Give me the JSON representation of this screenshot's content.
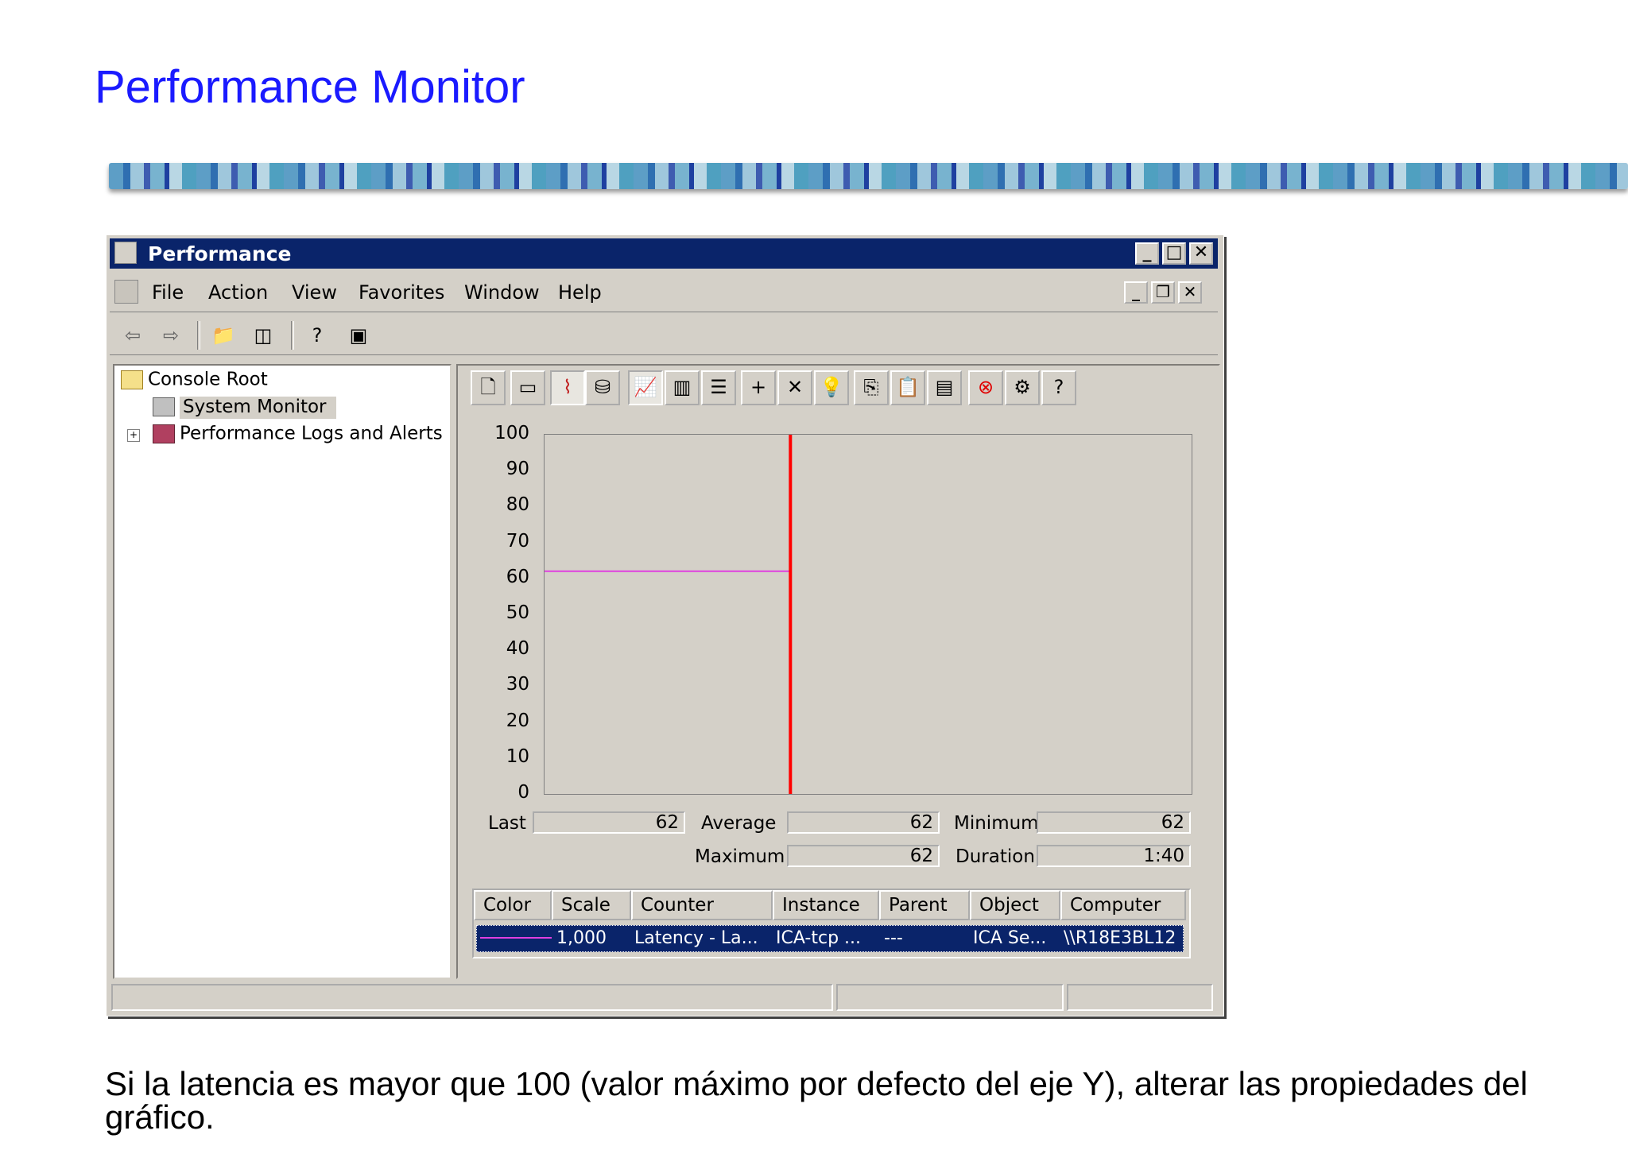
{
  "slide": {
    "title": "Performance Monitor",
    "caption": "Si la latencia es mayor que 100 (valor máximo por defecto del eje Y), alterar las propiedades del gráfico."
  },
  "window": {
    "title": "Performance",
    "menu": [
      "File",
      "Action",
      "View",
      "Favorites",
      "Window",
      "Help"
    ]
  },
  "tree": {
    "items": [
      {
        "label": "Console Root"
      },
      {
        "label": "System Monitor"
      },
      {
        "label": "Performance Logs and Alerts"
      }
    ]
  },
  "chart_data": {
    "type": "line",
    "ylim": [
      0,
      100
    ],
    "yticks": [
      "100",
      "90",
      "80",
      "70",
      "60",
      "50",
      "40",
      "30",
      "20",
      "10",
      "0"
    ],
    "series": [
      {
        "color": "#e040e0",
        "x": [
          0,
          38
        ],
        "y": [
          62,
          62
        ]
      }
    ],
    "cursor_x": 38,
    "x_range": [
      0,
      100
    ]
  },
  "stats": {
    "last_label": "Last",
    "last": "62",
    "average_label": "Average",
    "average": "62",
    "minimum_label": "Minimum",
    "minimum": "62",
    "maximum_label": "Maximum",
    "maximum": "62",
    "duration_label": "Duration",
    "duration": "1:40"
  },
  "counters": {
    "headers": [
      "Color",
      "Scale",
      "Counter",
      "Instance",
      "Parent",
      "Object",
      "Computer"
    ],
    "rows": [
      {
        "color": "#e040e0",
        "scale": "1,000",
        "counter": "Latency - La...",
        "instance": "ICA-tcp ...",
        "parent": "---",
        "object": "ICA Se...",
        "computer": "\\\\R18E3BL12"
      }
    ]
  }
}
